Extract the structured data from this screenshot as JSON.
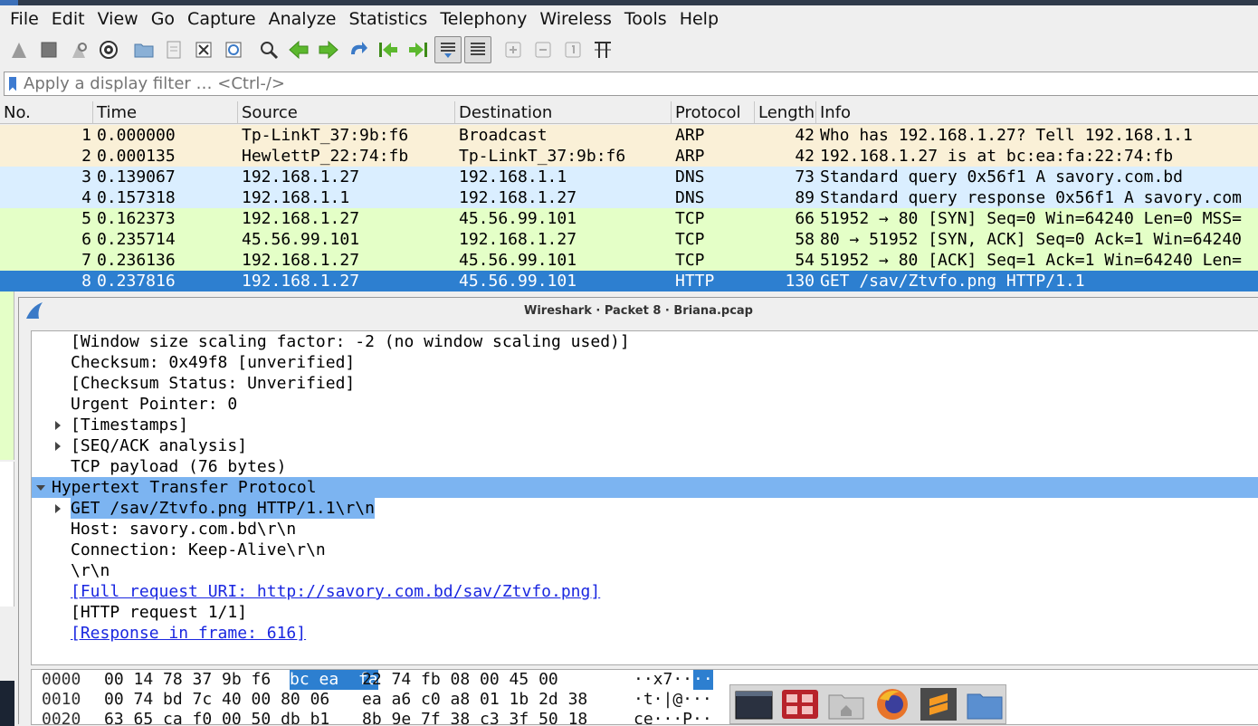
{
  "menubar": {
    "items": [
      {
        "label": "File"
      },
      {
        "label": "Edit"
      },
      {
        "label": "View"
      },
      {
        "label": "Go"
      },
      {
        "label": "Capture"
      },
      {
        "label": "Analyze"
      },
      {
        "label": "Statistics"
      },
      {
        "label": "Telephony"
      },
      {
        "label": "Wireless"
      },
      {
        "label": "Tools"
      },
      {
        "label": "Help"
      }
    ]
  },
  "filter": {
    "placeholder": "Apply a display filter … <Ctrl-/>"
  },
  "packet_list": {
    "headers": {
      "no": "No.",
      "time": "Time",
      "source": "Source",
      "destination": "Destination",
      "protocol": "Protocol",
      "length": "Length",
      "info": "Info"
    },
    "rows": [
      {
        "no": "1",
        "time": "0.000000",
        "source": "Tp-LinkT_37:9b:f6",
        "destination": "Broadcast",
        "protocol": "ARP",
        "length": "42",
        "info": "Who has 192.168.1.27? Tell 192.168.1.1",
        "color": "#faf0d7"
      },
      {
        "no": "2",
        "time": "0.000135",
        "source": "HewlettP_22:74:fb",
        "destination": "Tp-LinkT_37:9b:f6",
        "protocol": "ARP",
        "length": "42",
        "info": "192.168.1.27 is at bc:ea:fa:22:74:fb",
        "color": "#faf0d7"
      },
      {
        "no": "3",
        "time": "0.139067",
        "source": "192.168.1.27",
        "destination": "192.168.1.1",
        "protocol": "DNS",
        "length": "73",
        "info": "Standard query 0x56f1 A savory.com.bd",
        "color": "#daeeff"
      },
      {
        "no": "4",
        "time": "0.157318",
        "source": "192.168.1.1",
        "destination": "192.168.1.27",
        "protocol": "DNS",
        "length": "89",
        "info": "Standard query response 0x56f1 A savory.com",
        "color": "#daeeff"
      },
      {
        "no": "5",
        "time": "0.162373",
        "source": "192.168.1.27",
        "destination": "45.56.99.101",
        "protocol": "TCP",
        "length": "66",
        "info": "51952 → 80 [SYN] Seq=0 Win=64240 Len=0 MSS=",
        "color": "#e4ffc7"
      },
      {
        "no": "6",
        "time": "0.235714",
        "source": "45.56.99.101",
        "destination": "192.168.1.27",
        "protocol": "TCP",
        "length": "58",
        "info": "80 → 51952 [SYN, ACK] Seq=0 Ack=1 Win=64240",
        "color": "#e4ffc7"
      },
      {
        "no": "7",
        "time": "0.236136",
        "source": "192.168.1.27",
        "destination": "45.56.99.101",
        "protocol": "TCP",
        "length": "54",
        "info": "51952 → 80 [ACK] Seq=1 Ack=1 Win=64240 Len=",
        "color": "#e4ffc7"
      },
      {
        "no": "8",
        "time": "0.237816",
        "source": "192.168.1.27",
        "destination": "45.56.99.101",
        "protocol": "HTTP",
        "length": "130",
        "info": "GET /sav/Ztvfo.png HTTP/1.1",
        "color": "#2d7fd0",
        "selected": true
      }
    ]
  },
  "dialog": {
    "title": "Wireshark · Packet 8 · Briana.pcap",
    "tree": [
      {
        "text": "[Window size scaling factor: -2 (no window scaling used)]",
        "indent": 1
      },
      {
        "text": "Checksum: 0x49f8 [unverified]",
        "indent": 1
      },
      {
        "text": "[Checksum Status: Unverified]",
        "indent": 1
      },
      {
        "text": "Urgent Pointer: 0",
        "indent": 1
      },
      {
        "text": "[Timestamps]",
        "indent": 1,
        "arrow": "right"
      },
      {
        "text": "[SEQ/ACK analysis]",
        "indent": 1,
        "arrow": "right"
      },
      {
        "text": "TCP payload (76 bytes)",
        "indent": 1
      },
      {
        "text": "Hypertext Transfer Protocol",
        "indent": 0,
        "arrow": "down",
        "selected": true
      },
      {
        "text": "GET /sav/Ztvfo.png HTTP/1.1\\r\\n",
        "indent": 1,
        "arrow": "right",
        "subsel": true
      },
      {
        "text": "Host: savory.com.bd\\r\\n",
        "indent": 1
      },
      {
        "text": "Connection: Keep-Alive\\r\\n",
        "indent": 1
      },
      {
        "text": "\\r\\n",
        "indent": 1
      },
      {
        "text": "[Full request URI: http://savory.com.bd/sav/Ztvfo.png]",
        "indent": 1,
        "link": true
      },
      {
        "text": "[HTTP request 1/1]",
        "indent": 1
      },
      {
        "text": "[Response in frame: 616]",
        "indent": 1,
        "link": true
      }
    ],
    "hex": [
      {
        "offset": "0000",
        "bytes_a": "00 14 78 37 9b f6",
        "bytes_hl": "bc ea  fa",
        "bytes_b": "22 74 fb 08 00 45 00",
        "ascii": "··x7··",
        "ascii_hl": "··"
      },
      {
        "offset": "0010",
        "bytes_a": "00 74 bd 7c 40 00 80 06",
        "bytes_hl": "",
        "bytes_b": "ea a6 c0 a8 01 1b 2d 38",
        "ascii": "·t·|@···",
        "ascii_hl": ""
      },
      {
        "offset": "0020",
        "bytes_a": "63 65 ca f0 00 50 db b1",
        "bytes_hl": "",
        "bytes_b": "8b 9e 7f 38 c3 3f 50 18",
        "ascii": "ce···P··",
        "ascii_hl": ""
      }
    ]
  },
  "dock": {
    "items": [
      {
        "icon": "terminal-icon"
      },
      {
        "icon": "app-grid-icon"
      },
      {
        "icon": "home-folder-icon"
      },
      {
        "icon": "firefox-icon"
      },
      {
        "icon": "sublime-text-icon"
      },
      {
        "icon": "files-icon"
      }
    ]
  }
}
